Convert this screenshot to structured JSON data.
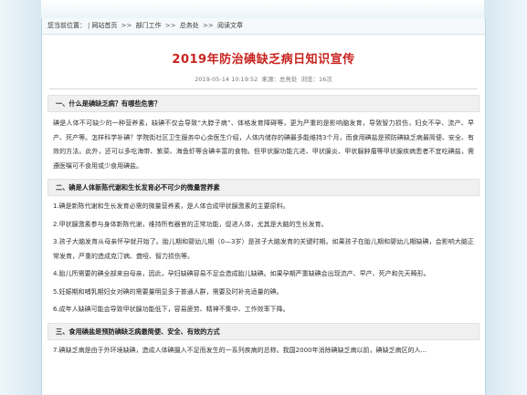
{
  "breadcrumb": {
    "prefix": "您当前位置：",
    "sep": ">>",
    "items": [
      "网站首页",
      "部门工作",
      "总务处",
      "阅读文章"
    ]
  },
  "article": {
    "title": "2019年防治碘缺乏病日知识宣传",
    "date": "2019-05-14 10:19:52",
    "source": "来源：总务处",
    "views": "浏览：16次"
  },
  "sections": [
    {
      "heading": "一、什么是碘缺乏病？有哪些危害？",
      "paragraphs": [
        "碘是人体不可缺少的一种营养素，缺碘不仅会导致“大脖子病”、体格发育障碍等，更为严重的是影响脑发育，导致智力损伤，妇女不孕、流产、早产、死产等。怎样科学补碘？学院街社区卫生服务中心余医生介绍，人体内储存的碘最多能维持3个月，而食用碘盐是预防碘缺乏病最简便、安全、有效的方法。此外，还可以多吃海带、紫菜、海鱼虾等含碘丰富的食物。但甲状腺功能亢进、甲状腺炎、甲状腺肿瘤等甲状腺疾病患者不宜吃碘盐，需遵医嘱可不食用或少食用碘盐。"
      ]
    },
    {
      "heading": "二、碘是人体新陈代谢和生长发育必不可少的微量营养素",
      "paragraphs": [
        "1.碘是新陈代谢和生长发育必需的微量营养素，是人体合成甲状腺激素的主要原料。",
        "2.甲状腺激素参与身体新陈代谢，维持所有器官的正常功能，促进人体，尤其是大脑的生长发育。",
        "3.孩子大脑发育从母亲怀孕就开始了。胎儿期和婴幼儿期（0—3岁）是孩子大脑发育的关键时期。如果孩子在胎儿期和婴幼儿期缺碘，会影响大脑正常发育，严重的造成克汀病、聋哑、智力损伤等。",
        "4.胎儿所需要的碘全部来自母亲，因此，孕妇缺碘容易不足会造成胎儿缺碘。如果孕期严重缺碘会出现流产、早产、死产和先天畸形。",
        "5.妊娠期和哺乳期妇女对碘的需要量明显多于普通人群，需要及时补充适量的碘。",
        "6.成年人缺碘可能会导致甲状腺功能低下，容易疲劳、精神不集中、工作效率下降。"
      ]
    },
    {
      "heading": "三、食用碘盐是预防碘缺乏病最简便、安全、有效的方式",
      "paragraphs": [
        "7.碘缺乏病是由于外环境缺碘，造成人体碘摄入不足而发生的一系列疾病的总称。我国2000年消除碘缺乏病以前，碘缺乏病区的人..."
      ]
    }
  ]
}
